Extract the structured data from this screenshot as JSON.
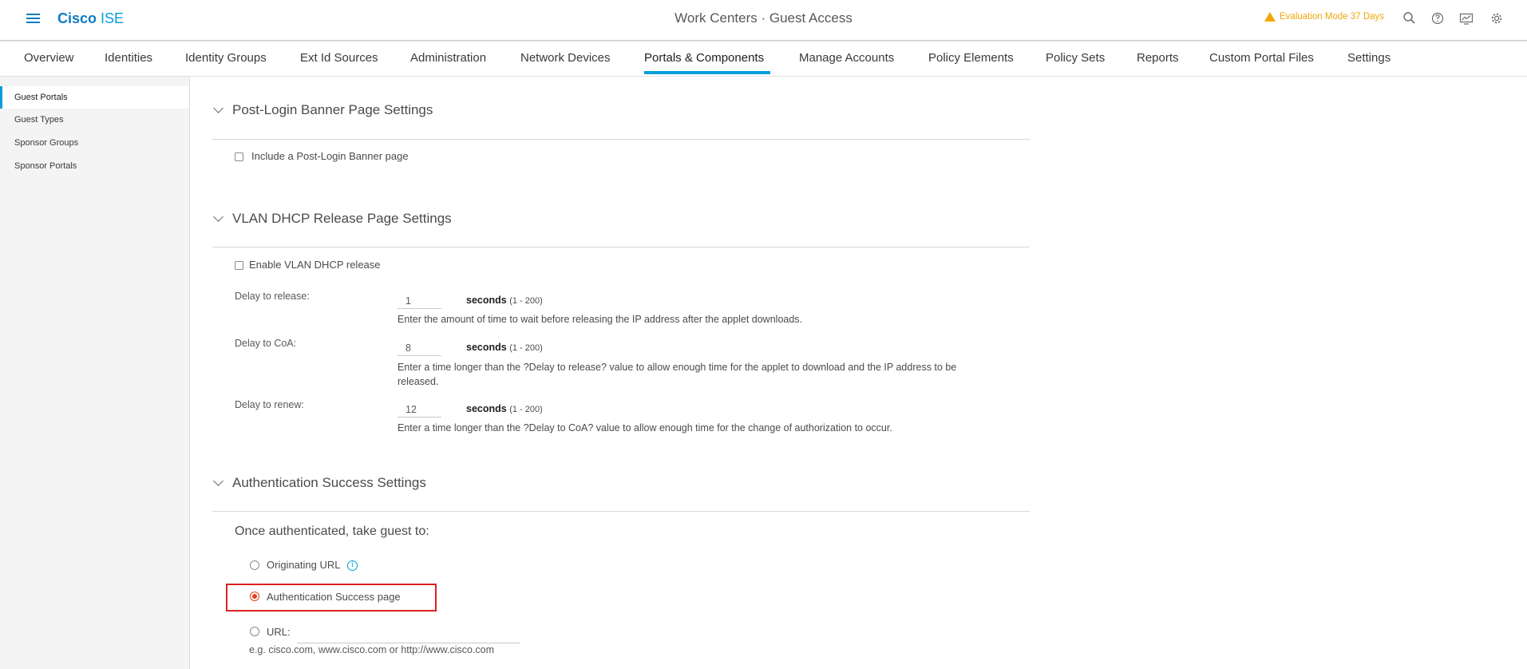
{
  "header": {
    "brand_bold": "Cisco",
    "brand_light": " ISE",
    "title": "Work Centers · Guest Access",
    "evaluation": "Evaluation Mode 37 Days"
  },
  "tabs": [
    {
      "label": "Overview"
    },
    {
      "label": "Identities"
    },
    {
      "label": "Identity Groups"
    },
    {
      "label": "Ext Id Sources"
    },
    {
      "label": "Administration"
    },
    {
      "label": "Network Devices"
    },
    {
      "label": "Portals & Components",
      "active": true
    },
    {
      "label": "Manage Accounts"
    },
    {
      "label": "Policy Elements"
    },
    {
      "label": "Policy Sets"
    },
    {
      "label": "Reports"
    },
    {
      "label": "Custom Portal Files"
    },
    {
      "label": "Settings"
    }
  ],
  "sidebar": {
    "items": [
      {
        "label": "Guest Portals",
        "active": true
      },
      {
        "label": "Guest Types"
      },
      {
        "label": "Sponsor Groups"
      },
      {
        "label": "Sponsor Portals"
      }
    ]
  },
  "post_login": {
    "title": "Post-Login Banner Page Settings",
    "checkbox_label": "Include a Post-Login Banner page",
    "checked": false
  },
  "vlan": {
    "title": "VLAN DHCP Release Page Settings",
    "checkbox_label": "Enable VLAN DHCP release",
    "checked": false,
    "unit": "seconds",
    "range": "(1 - 200)",
    "release": {
      "label": "Delay to release:",
      "value": "1",
      "help": "Enter the amount of time to wait before releasing the IP address after the applet downloads."
    },
    "coa": {
      "label": "Delay to CoA:",
      "value": "8",
      "help": "Enter a time longer than the ?Delay to release? value to allow enough time for the applet to download and the IP address to be released."
    },
    "renew": {
      "label": "Delay to renew:",
      "value": "12",
      "help": "Enter a time longer than the ?Delay to CoA? value to allow enough time for the change of authorization to occur."
    }
  },
  "auth_success": {
    "title": "Authentication Success Settings",
    "prompt": "Once authenticated, take guest to:",
    "opt_original": "Originating URL",
    "opt_success_page": "Authentication Success page",
    "opt_url": "URL:",
    "selected": "Authentication Success page",
    "example": "e.g. cisco.com, www.cisco.com or http://www.cisco.com"
  },
  "colors": {
    "accent": "#049fd9",
    "brand": "#0d7cc1",
    "warning": "#f0a70b",
    "radio_selected": "#e2401f",
    "highlight": "#e02020"
  }
}
